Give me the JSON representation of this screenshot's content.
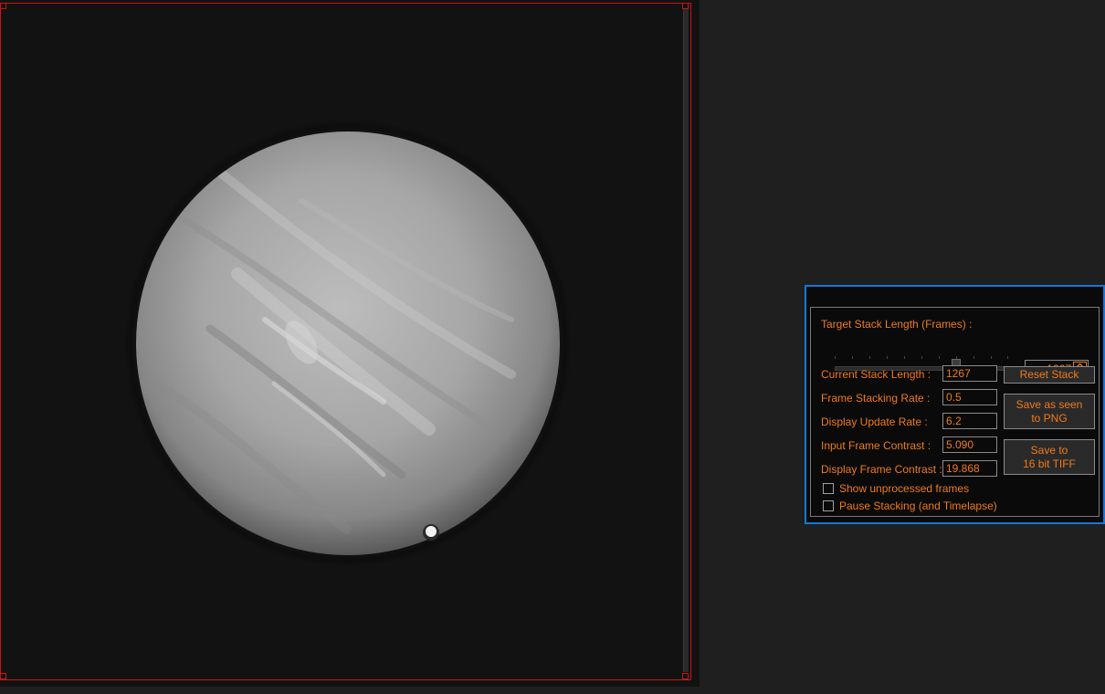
{
  "panel": {
    "target_stack_label": "Target Stack Length (Frames) :",
    "target_stack_value": "1267",
    "slider_fraction": 0.7,
    "rows": [
      {
        "label": "Current Stack Length :",
        "value": "1267"
      },
      {
        "label": "Frame Stacking Rate :",
        "value": "0.5"
      },
      {
        "label": "Display Update Rate :",
        "value": "6.2"
      },
      {
        "label": "Input Frame Contrast :",
        "value": "5.090"
      },
      {
        "label": "Display Frame Contrast :",
        "value": "19.868"
      }
    ],
    "buttons": {
      "reset": "Reset Stack",
      "save_png": "Save as seen\nto PNG",
      "save_tiff": "Save to\n16 bit TIFF"
    },
    "checkboxes": [
      {
        "label": "Show unprocessed frames",
        "checked": false
      },
      {
        "label": "Pause Stacking (and Timelapse)",
        "checked": false
      }
    ]
  },
  "colors": {
    "accent_text": "#f07a1a",
    "panel_border": "#1479d9",
    "viewer_border": "#c81414"
  },
  "icons": {
    "spin_up": "triangle-up-icon",
    "spin_down": "triangle-down-icon"
  }
}
